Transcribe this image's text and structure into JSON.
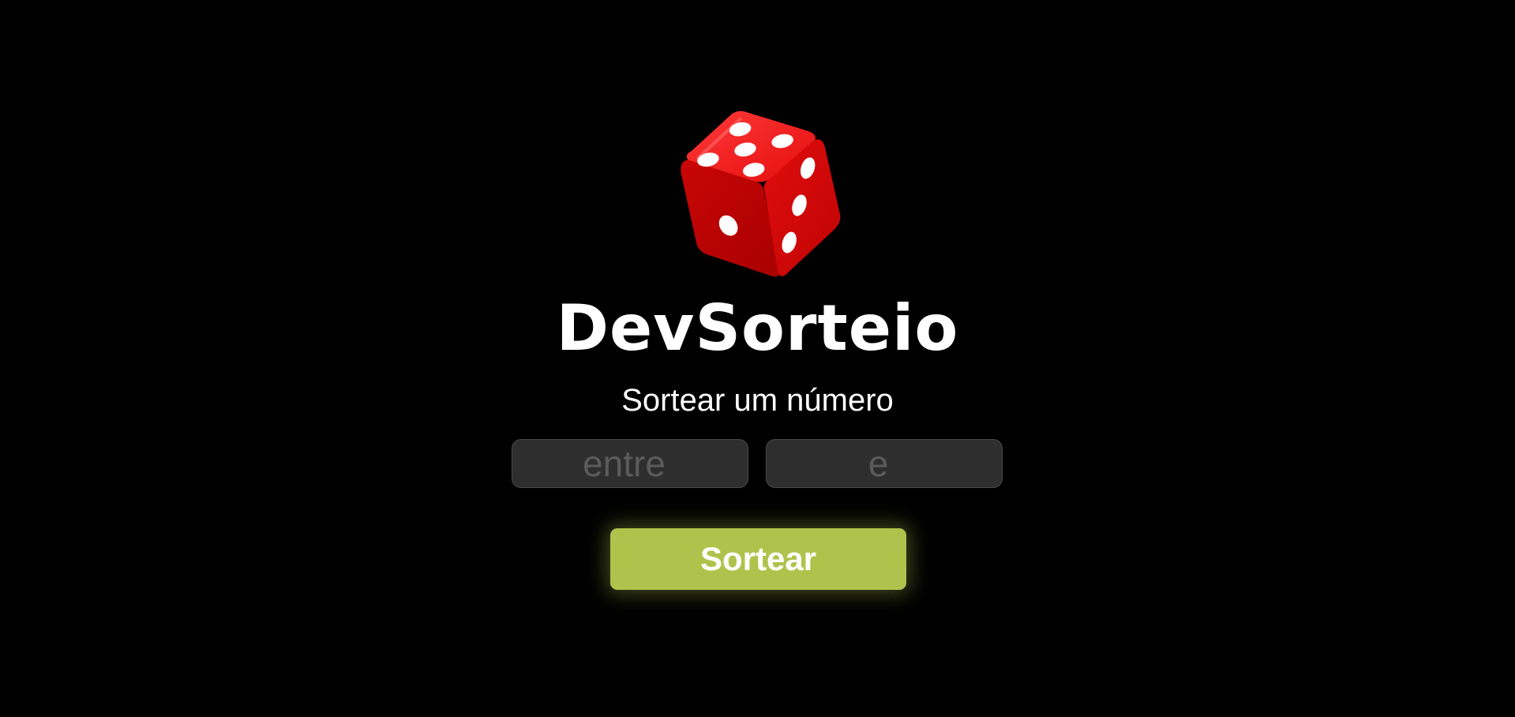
{
  "colors": {
    "background": "#000000",
    "accent": "#afc34c",
    "dice": "#e00b0b",
    "input_background": "#2e2e2e"
  },
  "logo": {
    "icon": "dice-icon"
  },
  "header": {
    "title": "DevSorteio",
    "subtitle": "Sortear um número"
  },
  "form": {
    "min_input": {
      "value": "",
      "placeholder": "entre"
    },
    "max_input": {
      "value": "",
      "placeholder": "e"
    },
    "submit_label": "Sortear"
  }
}
